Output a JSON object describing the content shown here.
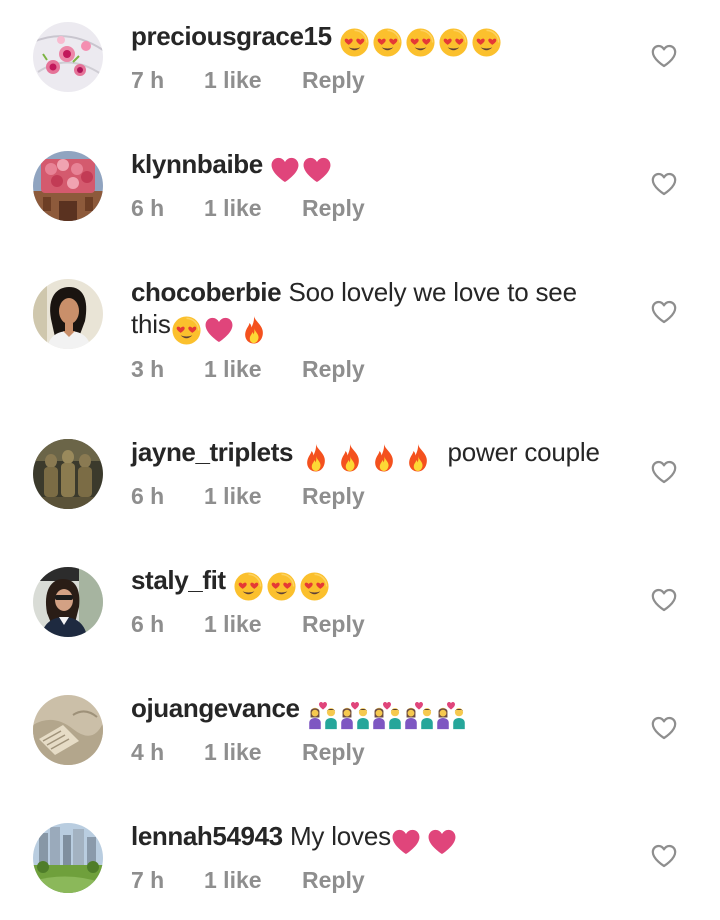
{
  "comments": [
    {
      "username": "preciousgrace15",
      "text": "",
      "emojis": [
        "heart-eyes-emoji",
        "heart-eyes-emoji",
        "heart-eyes-emoji",
        "heart-eyes-emoji",
        "heart-eyes-emoji"
      ],
      "time": "7 h",
      "likes": "1 like",
      "reply": "Reply"
    },
    {
      "username": "klynnbaibe",
      "text": "",
      "emojis": [
        "pink-heart-emoji",
        "pink-heart-emoji"
      ],
      "time": "6 h",
      "likes": "1 like",
      "reply": "Reply"
    },
    {
      "username": "chocoberbie",
      "text": "Soo lovely we love to see",
      "text_line2": "this",
      "emojis": [
        "heart-eyes-emoji",
        "pink-heart-emoji",
        "fire-emoji"
      ],
      "time": "3 h",
      "likes": "1 like",
      "reply": "Reply"
    },
    {
      "username": "jayne_triplets",
      "text": "power couple",
      "emojis": [
        "fire-emoji",
        "fire-emoji",
        "fire-emoji",
        "fire-emoji"
      ],
      "time": "6 h",
      "likes": "1 like",
      "reply": "Reply"
    },
    {
      "username": "staly_fit",
      "text": "",
      "emojis": [
        "heart-eyes-emoji",
        "heart-eyes-emoji",
        "heart-eyes-emoji"
      ],
      "time": "6 h",
      "likes": "1 like",
      "reply": "Reply"
    },
    {
      "username": "ojuangevance",
      "text": "",
      "emojis": [
        "couple-with-heart-emoji",
        "couple-with-heart-emoji",
        "couple-with-heart-emoji",
        "couple-with-heart-emoji",
        "couple-with-heart-emoji"
      ],
      "time": "4 h",
      "likes": "1 like",
      "reply": "Reply"
    },
    {
      "username": "lennah54943",
      "text": "My loves",
      "emojis": [
        "pink-heart-emoji",
        "pink-heart-emoji"
      ],
      "time": "7 h",
      "likes": "1 like",
      "reply": "Reply"
    }
  ],
  "colors": {
    "username": "#262626",
    "meta": "#8e8e8e",
    "heart_outline": "#8e8e8e",
    "pink_heart": "#e0457b",
    "emoji_yellow": "#fbc02d",
    "fire_orange": "#f4511e"
  },
  "icons": {
    "like": "heart-outline-icon"
  }
}
